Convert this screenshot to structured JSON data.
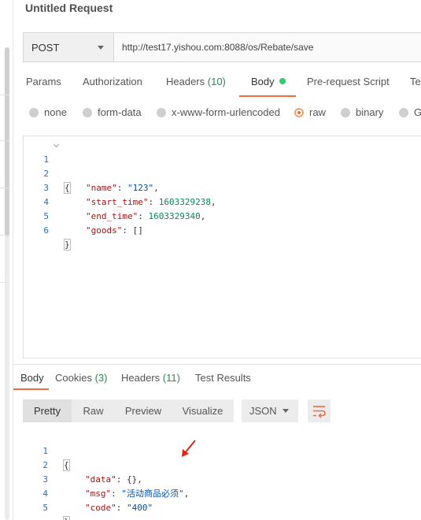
{
  "request": {
    "title": "Untitled Request",
    "method": "POST",
    "url": "http://test17.yishou.com:8088/os/Rebate/save"
  },
  "request_tabs": {
    "params": "Params",
    "authorization": "Authorization",
    "headers": "Headers",
    "headers_count": "(10)",
    "body": "Body",
    "prerequest": "Pre-request Script",
    "tests": "Te"
  },
  "body_types": {
    "none": "none",
    "form_data": "form-data",
    "urlencoded": "x-www-form-urlencoded",
    "raw": "raw",
    "binary": "binary",
    "graphql": "Gr",
    "selected": "raw"
  },
  "request_body": {
    "line_numbers": [
      "1",
      "2",
      "3",
      "4",
      "5",
      "6"
    ],
    "open_brace": "{",
    "close_brace": "}",
    "name_key": "\"name\"",
    "name_val": "\"123\"",
    "start_key": "\"start_time\"",
    "start_val": "1603329238",
    "end_key": "\"end_time\"",
    "end_val": "1603329340",
    "goods_key": "\"goods\"",
    "goods_val": "[]",
    "colon": ": ",
    "comma": ","
  },
  "response_tabs": {
    "body": "Body",
    "cookies": "Cookies",
    "cookies_count": "(3)",
    "headers": "Headers",
    "headers_count": "(11)",
    "test_results": "Test Results"
  },
  "response_toolbar": {
    "pretty": "Pretty",
    "raw": "Raw",
    "preview": "Preview",
    "visualize": "Visualize",
    "format": "JSON"
  },
  "response_body": {
    "line_numbers": [
      "1",
      "2",
      "3",
      "4",
      "5"
    ],
    "open_brace": "{",
    "close_brace": "}",
    "data_key": "\"data\"",
    "data_val": "{}",
    "msg_key": "\"msg\"",
    "msg_val": "\"活动商品必须\"",
    "code_key": "\"code\"",
    "code_val": "\"400\"",
    "colon": ": ",
    "comma": ","
  },
  "colors": {
    "accent": "#f26b3a",
    "count_green": "#2e8b57",
    "annotation_arrow": "#e8241a"
  }
}
